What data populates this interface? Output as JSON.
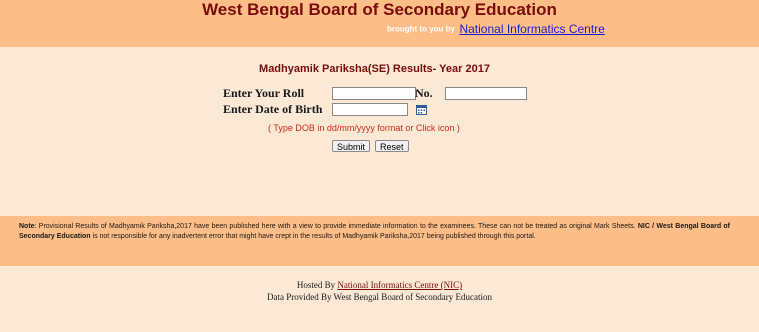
{
  "header": {
    "title": "West Bengal Board of Secondary Education",
    "brought_label": "brought to you by",
    "nic_link": "National Informatics Centre"
  },
  "form": {
    "title": "Madhyamik Pariksha(SE) Results- Year 2017",
    "roll_label": "Enter Your Roll",
    "no_label": "No.",
    "dob_label": "Enter Date of Birth",
    "roll_value": "",
    "no_value": "",
    "dob_value": "",
    "hint_open": "( ",
    "hint_text": "Type DOB in dd/mm/yyyy format or Click icon",
    "hint_close": " )",
    "submit_label": "Submit",
    "reset_label": "Reset"
  },
  "note": {
    "prefix": "Note",
    "text1": ": Provisional Results of Madhyamik Pariksha,2017 have been published here with a view to provide immediate information to the examinees. These can not be treated as original Mark Sheets. ",
    "bold": "NIC / West Bengal Board of Secondary Education",
    "text2": " is not responsible for any inadvertent error that might have crept in the results of Madhyamik Pariksha,2017 being published through this portal."
  },
  "footer": {
    "hosted_prefix": "Hosted By ",
    "hosted_link": "National Informatics Centre (NIC) ",
    "data_provided": "Data Provided By West Bengal Board of Secondary Education"
  },
  "colors": {
    "header_bg": "#fdbd86",
    "page_bg": "#fbe9d6",
    "title": "#7b0c0c",
    "hint": "#d02a1a",
    "link": "#1b1bd6"
  }
}
